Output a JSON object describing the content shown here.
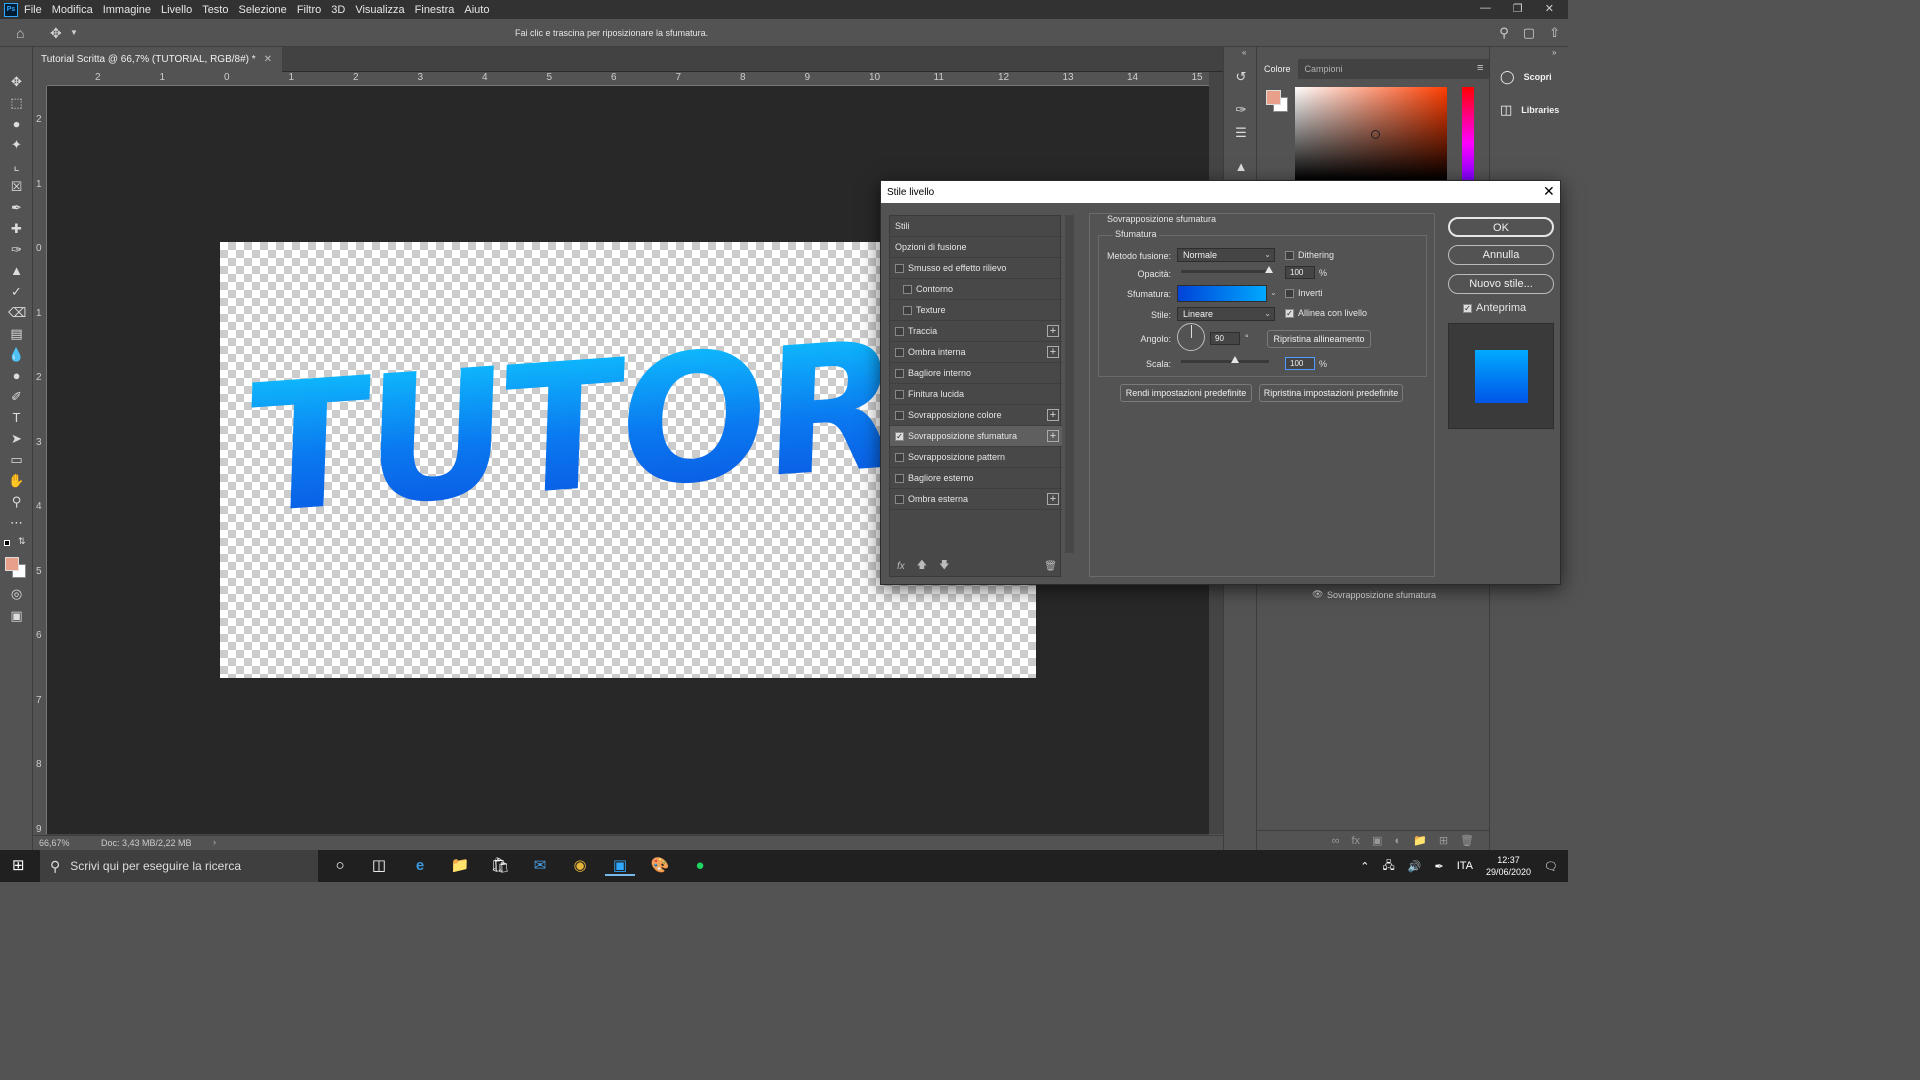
{
  "menubar": {
    "logo": "Ps",
    "items": [
      "File",
      "Modifica",
      "Immagine",
      "Livello",
      "Testo",
      "Selezione",
      "Filtro",
      "3D",
      "Visualizza",
      "Finestra",
      "Aiuto"
    ]
  },
  "options_bar": {
    "hint": "Fai clic e trascina per riposizionare la sfumatura."
  },
  "document": {
    "tab_title": "Tutorial Scritta @ 66,7% (TUTORIAL, RGB/8#) *",
    "canvas_text": "TUTORIAL",
    "text_colors": [
      "#0fc4ff",
      "#0a55e0"
    ],
    "ruler_h": [
      "2",
      "1",
      "0",
      "1",
      "2",
      "3",
      "4",
      "5",
      "6",
      "7",
      "8",
      "9",
      "10",
      "11",
      "12",
      "13",
      "14",
      "15"
    ],
    "ruler_v": [
      "2",
      "1",
      "0",
      "1",
      "2",
      "3",
      "4",
      "5",
      "6",
      "7",
      "8",
      "9"
    ]
  },
  "status": {
    "zoom": "66,67%",
    "doc_info": "Doc: 3,43 MB/2,22 MB"
  },
  "color_panel": {
    "tabs": [
      "Colore",
      "Campioni"
    ],
    "active_tab": "Colore",
    "foreground": "#e8a08a",
    "background": "#ffffff"
  },
  "side_panel": {
    "items": [
      "Scopri",
      "Libraries"
    ]
  },
  "layers": {
    "effect_label": "Sovrapposizione sfumatura"
  },
  "dialog": {
    "title": "Stile livello",
    "styles": [
      {
        "label": "Stili",
        "checkbox": false,
        "checked": false,
        "plus": false,
        "indent": false
      },
      {
        "label": "Opzioni di fusione",
        "checkbox": false,
        "checked": false,
        "plus": false,
        "indent": false
      },
      {
        "label": "Smusso ed effetto rilievo",
        "checkbox": true,
        "checked": false,
        "plus": false,
        "indent": false
      },
      {
        "label": "Contorno",
        "checkbox": true,
        "checked": false,
        "plus": false,
        "indent": true
      },
      {
        "label": "Texture",
        "checkbox": true,
        "checked": false,
        "plus": false,
        "indent": true
      },
      {
        "label": "Traccia",
        "checkbox": true,
        "checked": false,
        "plus": true,
        "indent": false
      },
      {
        "label": "Ombra interna",
        "checkbox": true,
        "checked": false,
        "plus": true,
        "indent": false
      },
      {
        "label": "Bagliore interno",
        "checkbox": true,
        "checked": false,
        "plus": false,
        "indent": false
      },
      {
        "label": "Finitura lucida",
        "checkbox": true,
        "checked": false,
        "plus": false,
        "indent": false
      },
      {
        "label": "Sovrapposizione colore",
        "checkbox": true,
        "checked": false,
        "plus": true,
        "indent": false
      },
      {
        "label": "Sovrapposizione sfumatura",
        "checkbox": true,
        "checked": true,
        "plus": true,
        "indent": false,
        "selected": true
      },
      {
        "label": "Sovrapposizione pattern",
        "checkbox": true,
        "checked": false,
        "plus": false,
        "indent": false
      },
      {
        "label": "Bagliore esterno",
        "checkbox": true,
        "checked": false,
        "plus": false,
        "indent": false
      },
      {
        "label": "Ombra esterna",
        "checkbox": true,
        "checked": false,
        "plus": true,
        "indent": false
      }
    ],
    "footer_fx": "fx",
    "section_title": "Sovrapposizione sfumatura",
    "sub_title": "Sfumatura",
    "blend_label": "Metodo fusione:",
    "blend_value": "Normale",
    "dither_label": "Dithering",
    "opacity_label": "Opacità:",
    "opacity_value": "100",
    "opacity_level_pct": 100,
    "percent": "%",
    "gradient_label": "Sfumatura:",
    "gradient_colors": [
      "#0043d8",
      "#00a9ff"
    ],
    "reverse_label": "Inverti",
    "style_label": "Stile:",
    "style_value": "Lineare",
    "align_label": "Allinea con livello",
    "align_checked": true,
    "angle_label": "Angolo:",
    "angle_value": "90",
    "degree": "°",
    "reset_align": "Ripristina allineamento",
    "scale_label": "Scala:",
    "scale_value": "100",
    "scale_level_pct": 61,
    "make_default": "Rendi impostazioni predefinite",
    "reset_default": "Ripristina impostazioni predefinite",
    "ok": "OK",
    "cancel": "Annulla",
    "new_style": "Nuovo stile...",
    "preview_label": "Anteprima",
    "preview_checked": true
  },
  "taskbar": {
    "search_placeholder": "Scrivi qui per eseguire la ricerca",
    "language": "ITA",
    "time": "12:37",
    "date": "29/06/2020"
  }
}
